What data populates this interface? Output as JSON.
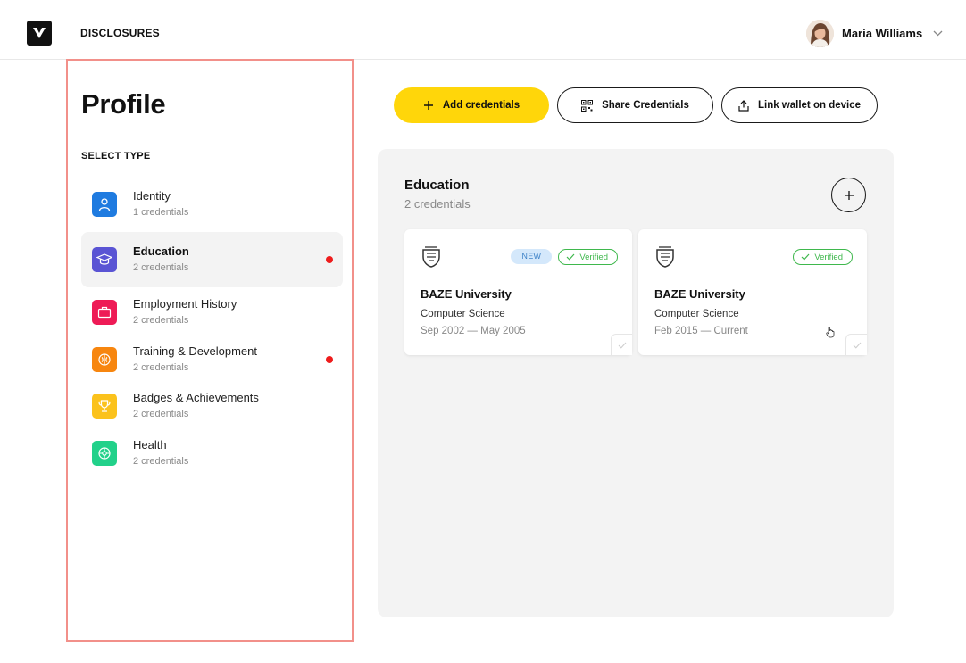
{
  "header": {
    "logo_letter": "V",
    "nav_label": "DISCLOSURES",
    "user_name": "Maria Williams"
  },
  "sidebar": {
    "title": "Profile",
    "section_label": "SELECT TYPE",
    "items": [
      {
        "label": "Identity",
        "count": "1 credentials",
        "icon": "user-icon",
        "color": "#1f7be0",
        "active": false,
        "dot": false
      },
      {
        "label": "Education",
        "count": "2 credentials",
        "icon": "graduation-cap-icon",
        "color": "#5a54d4",
        "active": true,
        "dot": true
      },
      {
        "label": "Employment History",
        "count": "2 credentials",
        "icon": "briefcase-icon",
        "color": "#ee1b56",
        "active": false,
        "dot": false
      },
      {
        "label": "Training & Development",
        "count": "2 credentials",
        "icon": "brain-icon",
        "color": "#f7860f",
        "active": false,
        "dot": true
      },
      {
        "label": "Badges & Achievements",
        "count": "2 credentials",
        "icon": "trophy-icon",
        "color": "#fbc21c",
        "active": false,
        "dot": false
      },
      {
        "label": "Health",
        "count": "2 credentials",
        "icon": "health-icon",
        "color": "#22d18a",
        "active": false,
        "dot": false
      }
    ]
  },
  "actions": {
    "add_label": "Add credentials",
    "share_label": "Share Credentials",
    "link_label": "Link wallet on device"
  },
  "panel": {
    "title": "Education",
    "count": "2 credentials",
    "cards": [
      {
        "institution": "BAZE University",
        "program": "Computer Science",
        "dates": "Sep 2002 — May 2005",
        "new_badge": "NEW",
        "verified": "Verified"
      },
      {
        "institution": "BAZE University",
        "program": "Computer Science",
        "dates": "Feb 2015 — Current",
        "verified": "Verified"
      }
    ]
  },
  "colors": {
    "accent_yellow": "#ffd60a",
    "sidebar_border": "#f2908a",
    "verified_green": "#3fb84d",
    "notification_red": "#ee1c1c"
  }
}
